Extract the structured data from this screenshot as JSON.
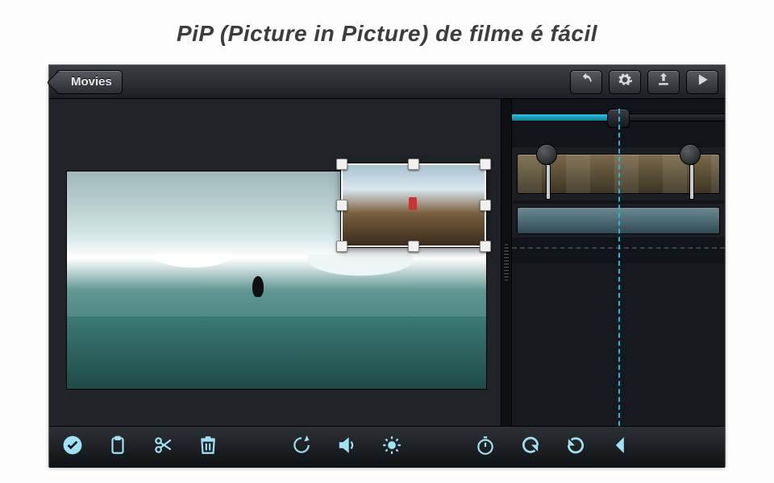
{
  "page": {
    "title": "PiP (Picture in Picture) de filme é fácil"
  },
  "topbar": {
    "back_label": "Movies",
    "buttons": {
      "undo": "undo",
      "settings": "settings",
      "share": "share",
      "play": "play"
    }
  },
  "pip": {
    "selected": true
  },
  "timeline": {
    "zoom_fraction": 0.5
  },
  "tools": {
    "approve": "approve",
    "copy": "copy",
    "cut": "cut",
    "delete": "delete",
    "rotate": "rotate",
    "volume": "volume",
    "brightness": "brightness",
    "timer": "timer",
    "redo": "redo",
    "undo_loop": "undo",
    "more": "more"
  }
}
